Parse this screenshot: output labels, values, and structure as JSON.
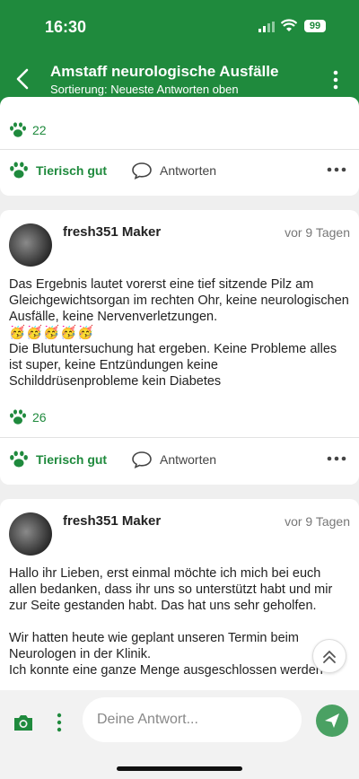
{
  "status_bar": {
    "time": "16:30",
    "battery": "99"
  },
  "header": {
    "title": "Amstaff neurologische Ausfälle",
    "subtitle": "Sortierung: Neueste Antworten oben"
  },
  "posts": [
    {
      "likes": "22",
      "actions": {
        "like_label": "Tierisch gut",
        "reply_label": "Antworten"
      }
    },
    {
      "author": "fresh351 Maker",
      "date": "vor 9 Tagen",
      "text1": "Das Ergebnis lautet vorerst eine tief sitzende Pilz am Gleichgewichtsorgan im rechten Ohr, keine neurologischen Ausfälle, keine Nervenverletzungen.",
      "emoji": "🥳🥳🥳🥳🥳",
      "text2": "Die Blutuntersuchung hat ergeben. Keine Probleme alles ist super, keine Entzündungen keine Schilddrüsenprobleme kein Diabetes",
      "likes": "26",
      "actions": {
        "like_label": "Tierisch gut",
        "reply_label": "Antworten"
      }
    },
    {
      "author": "fresh351 Maker",
      "date": "vor 9 Tagen",
      "text1": "Hallo ihr Lieben, erst einmal möchte ich mich bei euch allen bedanken, dass ihr uns so unterstützt habt und mir zur Seite gestanden habt. Das hat uns sehr geholfen.",
      "text2": "Wir hatten heute wie geplant unseren Termin beim Neurologen in der Klinik.",
      "text3": "Ich konnte eine ganze Menge ausgeschlossen werden"
    }
  ],
  "composer": {
    "placeholder": "Deine Antwort..."
  },
  "colors": {
    "brand": "#1f8a3d",
    "send": "#4aa163"
  }
}
